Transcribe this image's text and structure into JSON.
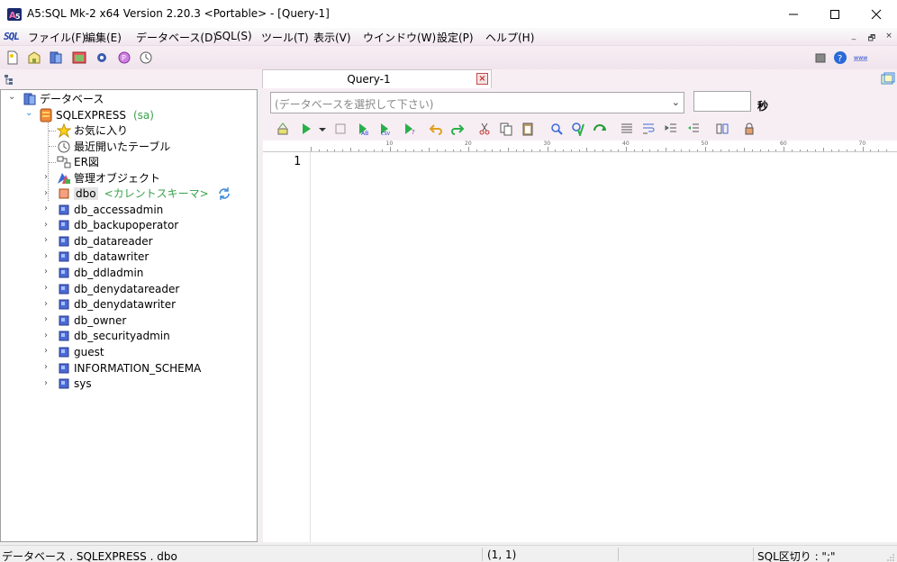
{
  "window": {
    "title": "A5:SQL Mk-2 x64 Version 2.20.3 <Portable> - [Query-1]",
    "minimize": "minimize",
    "maximize": "maximize",
    "close": "close"
  },
  "menu": {
    "logo": "SQL",
    "items": [
      "ファイル(F)",
      "編集(E)",
      "データベース(D)",
      "SQL(S)",
      "ツール(T)",
      "表示(V)",
      "ウインドウ(W)",
      "設定(P)",
      "ヘルプ(H)"
    ],
    "mdi_min": "_",
    "mdi_restore": "🗗",
    "mdi_close": "×"
  },
  "tree": {
    "root": "データベース",
    "server": "SQLEXPRESS",
    "server_user": "(sa)",
    "favorites": "お気に入り",
    "recent": "最近開いたテーブル",
    "er": "ER図",
    "admin": "管理オブジェクト",
    "current_schema": "dbo",
    "current_schema_label": "<カレントスキーマ>",
    "schemas": [
      "db_accessadmin",
      "db_backupoperator",
      "db_datareader",
      "db_datawriter",
      "db_ddladmin",
      "db_denydatareader",
      "db_denydatawriter",
      "db_owner",
      "db_securityadmin",
      "guest",
      "INFORMATION_SCHEMA",
      "sys"
    ]
  },
  "editor": {
    "tab_label": "Query-1",
    "tab_close": "×",
    "db_select_placeholder": "(データベースを選択して下さい)",
    "seconds_label": "秒",
    "ruler_numbers": [
      "10",
      "20",
      "30",
      "40",
      "50",
      "60",
      "70"
    ],
    "line_number": "1"
  },
  "status": {
    "path": "データベース . SQLEXPRESS . dbo",
    "cursor": "(1, 1)",
    "delimiter": "SQL区切り : \";\""
  },
  "colors": {
    "accent_pink": "#f1e6ee",
    "green_text": "#3aa24a",
    "close_red": "#c83232"
  }
}
